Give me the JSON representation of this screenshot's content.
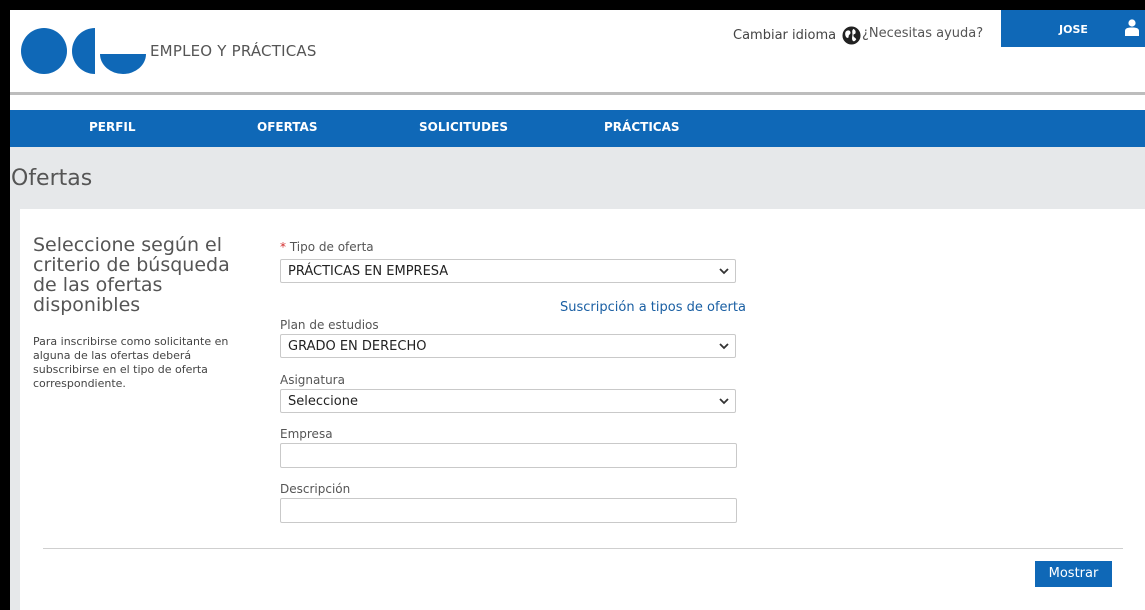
{
  "header": {
    "brand": "EMPLEO Y PRÁCTICAS",
    "change_language": "Cambiar idioma",
    "help": "¿Necesitas ayuda?",
    "user_name": "JOSE"
  },
  "nav": {
    "items": [
      {
        "label": "PERFIL"
      },
      {
        "label": "OFERTAS"
      },
      {
        "label": "SOLICITUDES"
      },
      {
        "label": "PRÁCTICAS"
      }
    ]
  },
  "page": {
    "title": "Ofertas"
  },
  "intro": {
    "heading": "Seleccione según el criterio de búsqueda de las ofertas disponibles",
    "description": "Para inscribirse como solicitante en alguna de las ofertas deberá subscribirse en el tipo de oferta correspondiente."
  },
  "form": {
    "offer_type": {
      "label": "Tipo de oferta",
      "required_mark": "*",
      "value": "PRÁCTICAS EN EMPRESA"
    },
    "subscription_link": "Suscripción a tipos de oferta",
    "study_plan": {
      "label": "Plan de estudios",
      "value": "GRADO EN DERECHO"
    },
    "subject": {
      "label": "Asignatura",
      "value": "Seleccione"
    },
    "company": {
      "label": "Empresa",
      "value": ""
    },
    "description": {
      "label": "Descripción",
      "value": ""
    },
    "submit_label": "Mostrar"
  },
  "colors": {
    "primary": "#0f68b7",
    "title_band": "#e6e8ea",
    "link": "#1a5fa3",
    "required": "#d32f2f"
  },
  "icons": [
    "logo",
    "globe-icon",
    "user-icon",
    "chevron-down-icon"
  ]
}
